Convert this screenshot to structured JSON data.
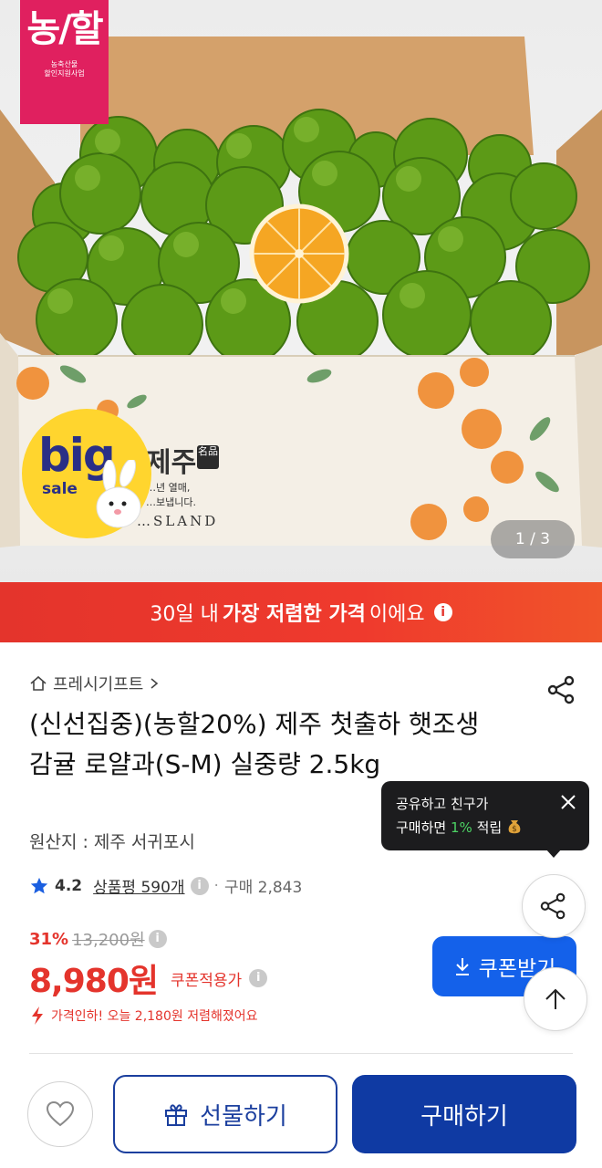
{
  "hero": {
    "badge_main": "농/할",
    "badge_sub": "농축산물\n할인지원사업",
    "sale_big": "big",
    "sale_small": "sale",
    "box_brand": "제주",
    "box_stamp": "名品",
    "box_line1": "…년 열매,",
    "box_line2": "…보냅니다.",
    "box_island": "…SLAND",
    "counter": "1 / 3"
  },
  "banner": {
    "prefix": "30일 내",
    "emphasis": "가장 저렴한 가격",
    "suffix": "이에요",
    "info_icon": "i"
  },
  "product": {
    "breadcrumb": "프레시기프트",
    "title": "(신선집중)(농할20%) 제주 첫출하 햇조생 감귤 로얄과(S-M) 실중량 2.5kg",
    "origin": "원산지 : 제주 서귀포시",
    "rating": "4.2",
    "reviews": "상품평 590개",
    "sales": "구매 2,843",
    "discount_pct": "31%",
    "original_price": "13,200원",
    "price": "8,980원",
    "coupon_note": "쿠폰적용가",
    "price_drop": "가격인하! 오늘 2,180원 저렴해졌어요"
  },
  "tooltip": {
    "line1": "공유하고 친구가",
    "line2_prefix": "구매하면",
    "line2_pct": "1%",
    "line2_suffix": "적립"
  },
  "coupon_button": {
    "label": "쿠폰받기"
  },
  "bottom": {
    "gift_label": "선물하기",
    "buy_label": "구매하기"
  },
  "colors": {
    "accent_red": "#e4342c",
    "brand_blue": "#1461ea",
    "buy_blue": "#0f3aa3",
    "badge_pink": "#e0205f",
    "tooltip_green": "#4cd264"
  },
  "icons": [
    "home-icon",
    "chevron-right-icon",
    "share-icon",
    "star-icon",
    "info-icon",
    "close-icon",
    "download-icon",
    "arrow-up-icon",
    "heart-icon",
    "gift-icon",
    "coin-icon",
    "lightning-icon"
  ]
}
